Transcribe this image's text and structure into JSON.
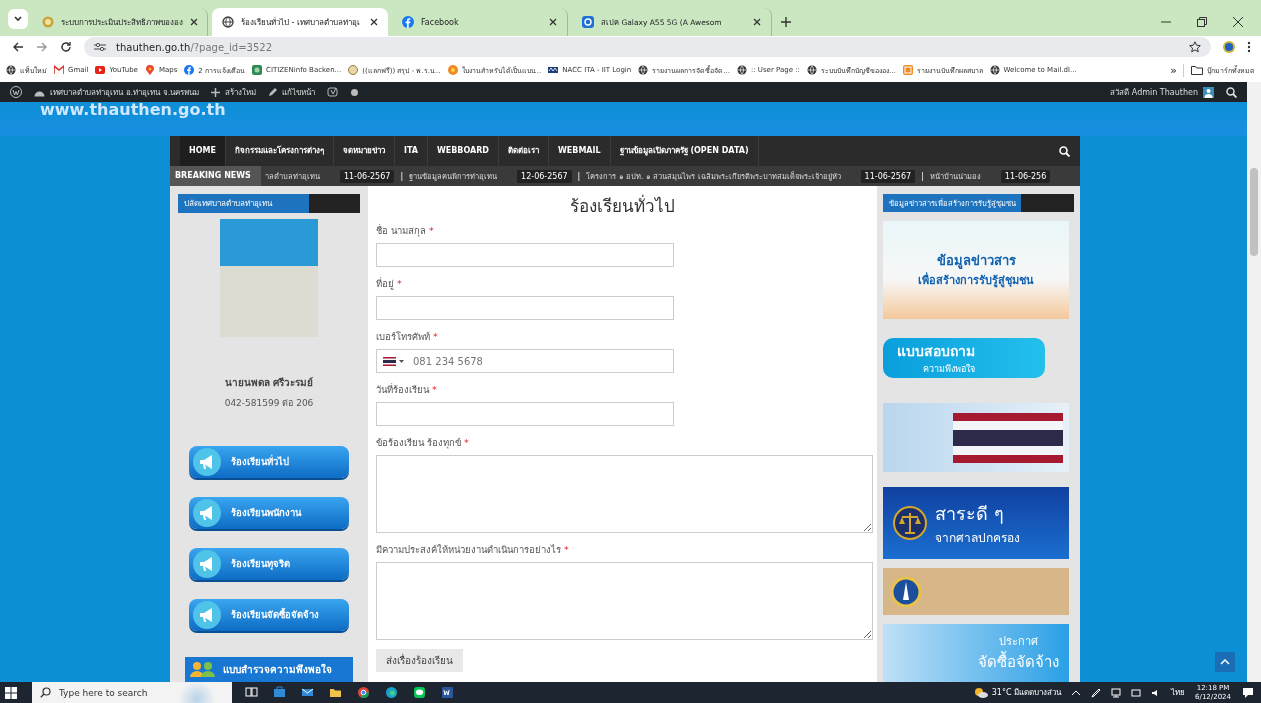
{
  "browser": {
    "tabs": [
      {
        "title": "ระบบการประเมินประสิทธิภาพขององ",
        "selected": false
      },
      {
        "title": "ร้องเรียนทั่วไป - เทศบาลตำบลท่าอุเ",
        "selected": true
      },
      {
        "title": "Facebook",
        "selected": false
      },
      {
        "title": "สเปค Galaxy A55 5G (A Awesom",
        "selected": false
      }
    ],
    "address": "thauthen.go.th/?page_id=3522",
    "bookmarks": [
      "แท็บใหม่",
      "Gmail",
      "YouTube",
      "Maps",
      "2 การแจ้งเตือน",
      "CITIZENinfo Backen...",
      "((แลกฟรี)) สรุป - พ.ร.บ...",
      "ใบงานสำหรับได้เป็นแบบ...",
      "NACC ITA - IIT Login",
      "รายงานผลการจัดซื้อจัด...",
      ":: User Page ::",
      "ระบบบันทึกบัญชีขององ...",
      "รายงานบันทึกผลสบาล",
      "Welcome to Mail.dl..."
    ],
    "bookmarks_more": "»",
    "all_bookmarks": "บุ๊กมาร์กทั้งหมด"
  },
  "admin_bar": {
    "site": "เทศบาลตำบลท่าอุเทน อ.ท่าอุเทน จ.นครพนม",
    "new": "สร้างใหม่",
    "edit": "แก้ไขหน้า",
    "greeting": "สวัสดี Admin Thauthen"
  },
  "site": {
    "header_url": "www.thauthen.go.th",
    "nav": [
      {
        "label": "HOME",
        "selected": true
      },
      {
        "label": "กิจกรรมและโครงการต่างๆ",
        "selected": false
      },
      {
        "label": "จดหมายข่าว",
        "selected": false
      },
      {
        "label": "ITA",
        "selected": false
      },
      {
        "label": "WEBBOARD",
        "selected": false
      },
      {
        "label": "ติดต่อเรา",
        "selected": false
      },
      {
        "label": "WEBMAIL",
        "selected": false
      },
      {
        "label": "ฐานข้อมูลเปิดภาครัฐ (OPEN DATA)",
        "selected": false
      }
    ],
    "breaking_label": "BREAKING NEWS",
    "ticker": [
      {
        "kind": "headline",
        "text": "าลตำบลท่าอุเทน"
      },
      {
        "kind": "date",
        "text": "11-06-2567"
      },
      {
        "kind": "separator",
        "text": "|"
      },
      {
        "kind": "headline",
        "text": "ฐานข้อมูลคนพิการท่าอุเทน"
      },
      {
        "kind": "date",
        "text": "12-06-2567"
      },
      {
        "kind": "separator",
        "text": "|"
      },
      {
        "kind": "headline",
        "text": "โครงการ ๑ อปท. ๑ สวนสมุนไพร เฉลิมพระเกียรติพระบาทสมเด็จพระเจ้าอยู่หัว"
      },
      {
        "kind": "date",
        "text": "11-06-2567"
      },
      {
        "kind": "separator",
        "text": "|"
      },
      {
        "kind": "headline",
        "text": "หน้าบ้านน่ามอง"
      },
      {
        "kind": "date",
        "text": "11-06-256"
      }
    ]
  },
  "left": {
    "heading": "ปลัดเทศบาลตำบลท่าอุเทน",
    "person_name": "นายนพดล ศรีวะรมย์",
    "phone": "042-581599 ต่อ 206",
    "buttons": [
      "ร้องเรียนทั่วไป",
      "ร้องเรียนพนักงาน",
      "ร้องเรียนทุจริต",
      "ร้องเรียนจัดซื้อจัดจ้าง"
    ],
    "survey": "แบบสำรวจความพึงพอใจ"
  },
  "form": {
    "title": "ร้องเรียนทั่วไป",
    "required_mark": "*",
    "fields": [
      {
        "kind": "text",
        "label": "ชื่อ นามสกุล",
        "required": true
      },
      {
        "kind": "text",
        "label": "ที่อยู่",
        "required": true
      },
      {
        "kind": "phone",
        "label": "เบอร์โทรศัพท์",
        "required": true,
        "placeholder": "081 234 5678"
      },
      {
        "kind": "text",
        "label": "วันที่ร้องเรียน",
        "required": true
      },
      {
        "kind": "textarea",
        "label": "ข้อร้องเรียน ร้องทุกข์",
        "required": true
      },
      {
        "kind": "textarea",
        "label": "มีความประสงค์ให้หน่วยงานดำเนินการอย่างไร",
        "required": true
      }
    ],
    "submit": "ส่งเรื่องร้องเรียน"
  },
  "right": {
    "heading": "ข้อมูลข่าวสารเพื่อสร้างการรับรู้สู่ชุมชน",
    "banners": [
      {
        "kind": "info",
        "lines": [
          "ข้อมูลข่าวสาร",
          "เพื่อสร้างการรับรู้สู่ชุมชน"
        ]
      },
      {
        "kind": "survey",
        "lines": [
          "แบบสอบถาม",
          "ความพึงพอใจ"
        ]
      },
      {
        "kind": "flag"
      },
      {
        "kind": "court",
        "lines": [
          "สาระดี ๆ",
          "จากศาลปกครอง"
        ]
      },
      {
        "kind": "center"
      },
      {
        "kind": "procure",
        "lines": [
          "ประกาศ",
          "จัดซื้อจัดจ้าง"
        ]
      }
    ]
  },
  "taskbar": {
    "search_placeholder": "Type here to search",
    "weather": "31°C มีแดดบางส่วน",
    "language": "ไทย",
    "time": "12:18 PM",
    "date": "6/12/2024"
  }
}
